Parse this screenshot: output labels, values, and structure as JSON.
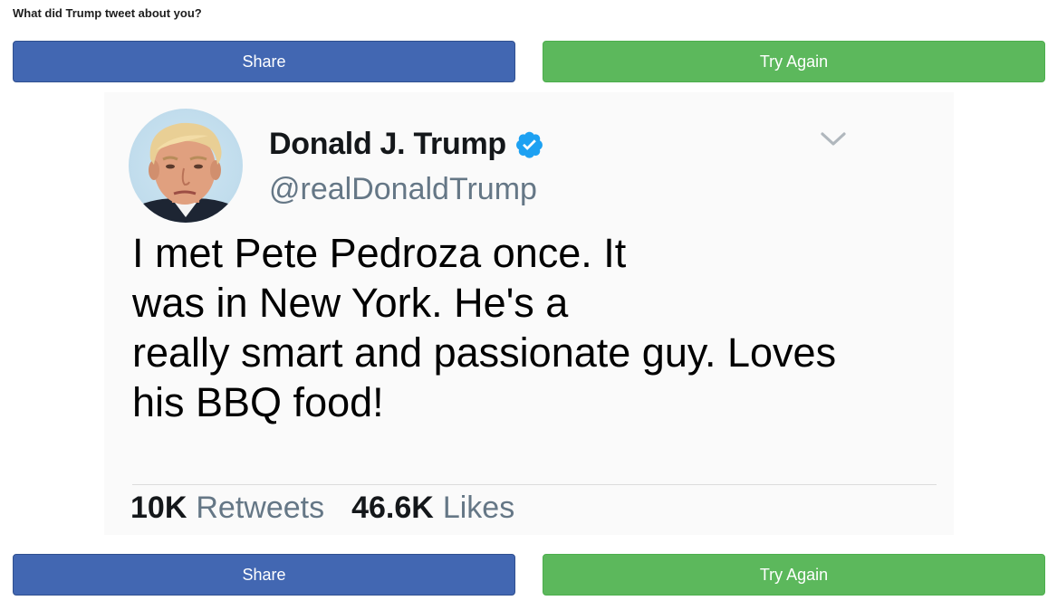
{
  "page": {
    "heading": "What did Trump tweet about you?"
  },
  "buttons": {
    "share_label": "Share",
    "try_again_label": "Try Again",
    "share_color": "#4267b2",
    "try_again_color": "#5cb85c"
  },
  "tweet": {
    "display_name": "Donald J. Trump",
    "handle": "@realDonaldTrump",
    "verified": true,
    "verified_icon": "verified-badge-icon",
    "menu_icon": "chevron-down-icon",
    "avatar": "profile-photo",
    "text_lines": [
      "I met Pete Pedroza once. It",
      "was in New York. He's a",
      "really smart and passionate guy. Loves",
      "his BBQ food!"
    ],
    "retweets_count": "10K",
    "retweets_label": "Retweets",
    "likes_count": "46.6K",
    "likes_label": "Likes",
    "accent_color": "#1da1f2"
  }
}
